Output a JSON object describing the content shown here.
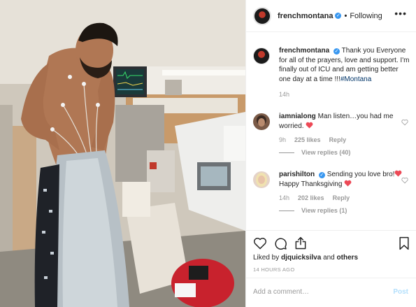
{
  "post": {
    "username": "frenchmontana",
    "follow_status": "Following",
    "dot": "•",
    "caption_user": "frenchmontana",
    "caption_text": "Thank you Everyone for all of the prayers, love and support. I'm finally out of ICU and am getting better one day at a time !!!",
    "caption_hashtag": "#Montana",
    "caption_time": "14h"
  },
  "comments": [
    {
      "user": "iamnialong",
      "text": "Man listen…you had me worried.",
      "time": "9h",
      "likes": "225 likes",
      "reply": "Reply",
      "view_replies": "View replies (40)"
    },
    {
      "user": "parishilton",
      "text_before": "Sending you love bro!",
      "text_after": " Happy Thanksgiving",
      "time": "14h",
      "likes": "202 likes",
      "reply": "Reply",
      "view_replies": "View replies (1)"
    }
  ],
  "liked_by": {
    "prefix": "Liked by",
    "user": "djquicksilva",
    "connector": "and",
    "others": "others"
  },
  "timestamp": "14 HOURS AGO",
  "comment_box": {
    "placeholder": "Add a comment…",
    "post_label": "Post"
  },
  "icons": {
    "more": "more-options-icon",
    "like": "heart-icon",
    "comment": "comment-icon",
    "share": "share-icon",
    "save": "bookmark-icon",
    "verified": "verified-badge-icon"
  },
  "colors": {
    "verified": "#3897f0",
    "emoji_heart": "#ed4956",
    "hashtag": "#003569",
    "muted": "#999999",
    "post_disabled": "#b2dffc"
  }
}
